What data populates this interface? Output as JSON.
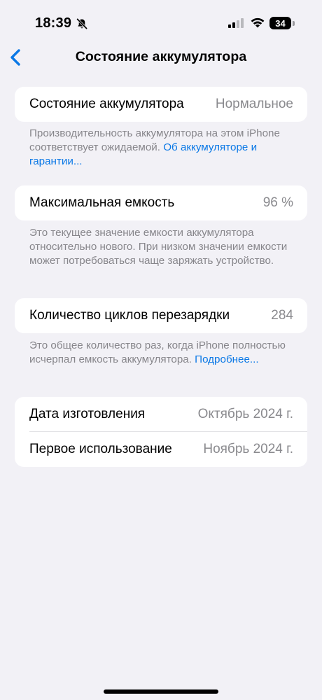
{
  "status": {
    "time": "18:39",
    "battery": "34"
  },
  "nav": {
    "title": "Состояние аккумулятора"
  },
  "health": {
    "label": "Состояние аккумулятора",
    "value": "Нормальное",
    "footnote": "Производительность аккумулятора на этом iPhone соответствует ожидаемой. ",
    "link": "Об аккуму­ляторе и гарантии..."
  },
  "capacity": {
    "label": "Максимальная емкость",
    "value": "96 %",
    "footnote": "Это текущее значение емкости аккумулятора относительно нового. При низком значении емкости может потребоваться чаще заряжать устройство."
  },
  "cycles": {
    "label": "Количество циклов перезарядки",
    "value": "284",
    "footnote": "Это общее количество раз, когда iPhone полностью исчерпал емкость аккумулятора. ",
    "link": "Подробнее..."
  },
  "dates": {
    "manufacture_label": "Дата изготовления",
    "manufacture_value": "Октябрь 2024 г.",
    "first_use_label": "Первое использование",
    "first_use_value": "Ноябрь 2024 г."
  }
}
